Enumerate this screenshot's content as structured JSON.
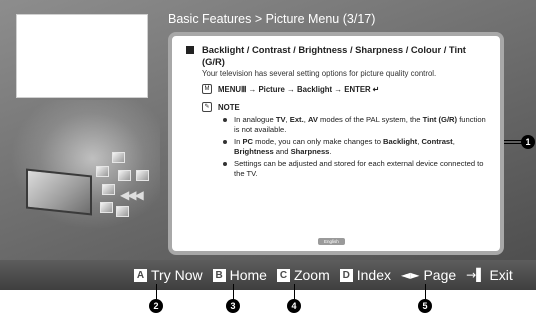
{
  "breadcrumb": "Basic Features > Picture Menu (3/17)",
  "content": {
    "title": "Backlight / Contrast / Brightness / Sharpness / Colour / Tint (G/R)",
    "description": "Your television has several setting options for picture quality control.",
    "menu_icon_text": "M",
    "menu_path": "MENUⅢ → Picture → Backlight → ENTER",
    "enter_glyph": "↵",
    "note_icon_text": "✎",
    "note_label": "NOTE",
    "notes": [
      {
        "pre": "In analogue ",
        "b1": "TV",
        "m1": ", ",
        "b2": "Ext.",
        "m2": ", ",
        "b3": "AV",
        "m3": " modes of the PAL system, the ",
        "b4": "Tint (G/R)",
        "post": " function is not available."
      },
      {
        "pre": "In ",
        "b1": "PC",
        "m1": " mode, you can only make changes to ",
        "b2": "Backlight",
        "m2": ", ",
        "b3": "Contrast",
        "m3": ", ",
        "b4": "Brightness",
        "m4": " and ",
        "b5": "Sharpness",
        "post": "."
      },
      {
        "text": "Settings can be adjusted and stored for each external device connected to the TV."
      }
    ],
    "language_tag": "English"
  },
  "nav": {
    "left": "◄",
    "right": "►"
  },
  "bottom_bar": {
    "try_now": {
      "key": "A",
      "label": "Try Now"
    },
    "home": {
      "key": "B",
      "label": "Home"
    },
    "zoom": {
      "key": "C",
      "label": "Zoom"
    },
    "index": {
      "key": "D",
      "label": "Index"
    },
    "page": {
      "glyph": "◄►",
      "label": "Page"
    },
    "exit": {
      "glyph": "→▌",
      "label": "Exit"
    }
  },
  "callouts": [
    "1",
    "2",
    "3",
    "4",
    "5"
  ],
  "colors": {
    "screen_bg": "#6f6f6f",
    "panel_border": "#a8a8a8",
    "bar_bg": "#4a4a4a",
    "callout": "#000000"
  }
}
